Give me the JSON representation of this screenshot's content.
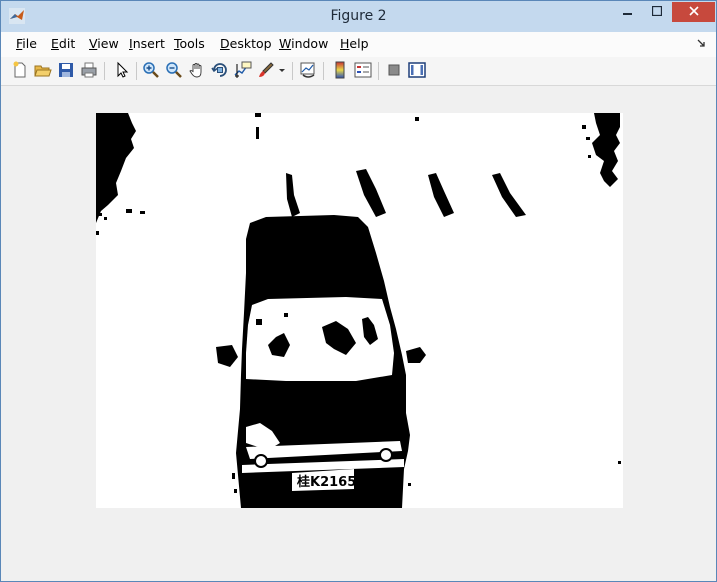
{
  "window": {
    "title": "Figure 2"
  },
  "menu": [
    {
      "label": "File",
      "mnemonic": "F",
      "rest": "ile"
    },
    {
      "label": "Edit",
      "mnemonic": "E",
      "rest": "dit"
    },
    {
      "label": "View",
      "mnemonic": "V",
      "rest": "iew"
    },
    {
      "label": "Insert",
      "mnemonic": "I",
      "rest": "nsert"
    },
    {
      "label": "Tools",
      "mnemonic": "T",
      "rest": "ools"
    },
    {
      "label": "Desktop",
      "mnemonic": "D",
      "rest": "esktop"
    },
    {
      "label": "Window",
      "mnemonic": "W",
      "rest": "indow"
    },
    {
      "label": "Help",
      "mnemonic": "H",
      "rest": "elp"
    }
  ],
  "toolbar": {
    "icons": [
      "new-figure-icon",
      "open-file-icon",
      "save-icon",
      "print-icon",
      "edit-plot-arrow-icon",
      "zoom-in-icon",
      "zoom-out-icon",
      "pan-hand-icon",
      "rotate-3d-icon",
      "data-cursor-icon",
      "brush-icon",
      "link-plot-icon",
      "colorbar-icon",
      "legend-icon",
      "hide-plot-tools-icon",
      "show-plot-tools-icon"
    ]
  },
  "figure": {
    "plate_text": "桂K2165"
  },
  "colors": {
    "titlebar": "#c4d9ee",
    "close": "#c7493d",
    "axes_bg": "#ffffff",
    "image_fg": "#000000"
  }
}
